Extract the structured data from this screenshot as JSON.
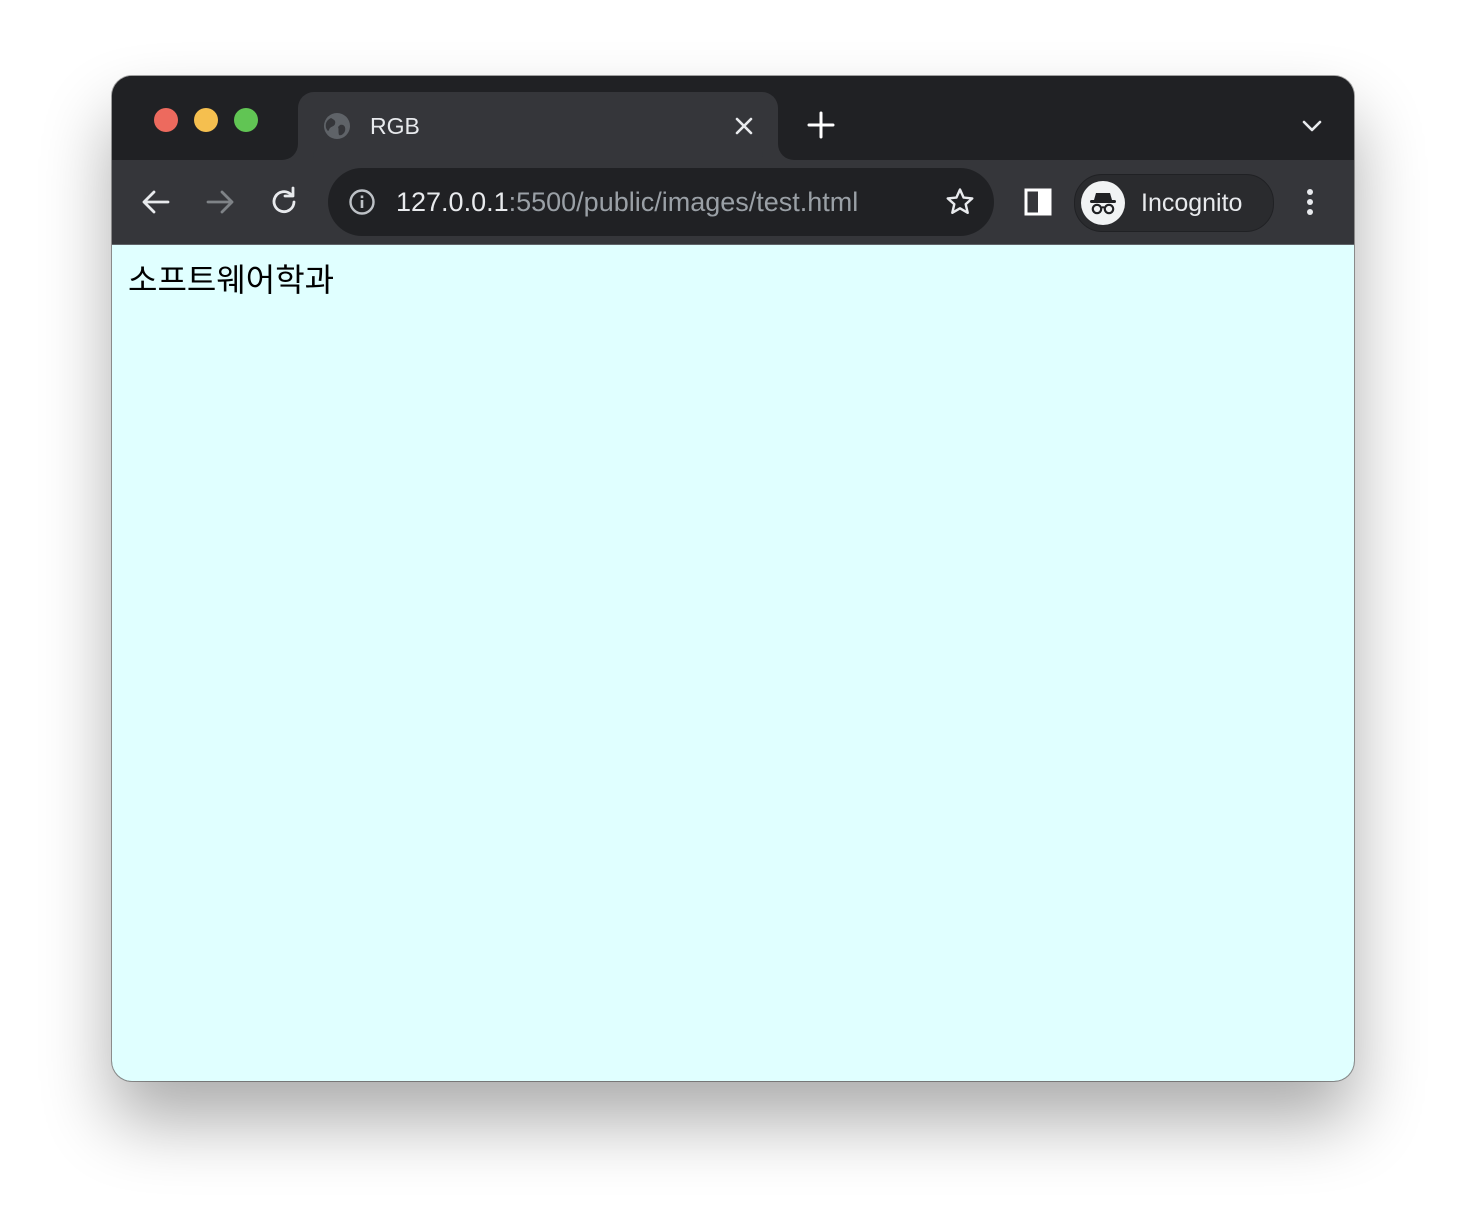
{
  "colors": {
    "tabstrip_bg": "#202124",
    "toolbar_bg": "#35363a",
    "omnibox_bg": "#202124",
    "page_bg": "#e0ffff",
    "traffic_red": "#ed6a5e",
    "traffic_yellow": "#f5bf4f",
    "traffic_green": "#61c554"
  },
  "tab": {
    "title": "RGB",
    "favicon": "globe-icon",
    "close_icon": "close-icon"
  },
  "toolbar": {
    "back_icon": "arrow-left-icon",
    "forward_icon": "arrow-right-icon",
    "reload_icon": "reload-icon",
    "side_panel_icon": "side-panel-icon",
    "menu_icon": "kebab-menu-icon"
  },
  "omnibox": {
    "info_icon": "info-icon",
    "url_host": "127.0.0.1",
    "url_rest": ":5500/public/images/test.html",
    "bookmark_icon": "star-icon"
  },
  "profile": {
    "label": "Incognito",
    "icon": "incognito-icon"
  },
  "page": {
    "text": "소프트웨어학과"
  }
}
